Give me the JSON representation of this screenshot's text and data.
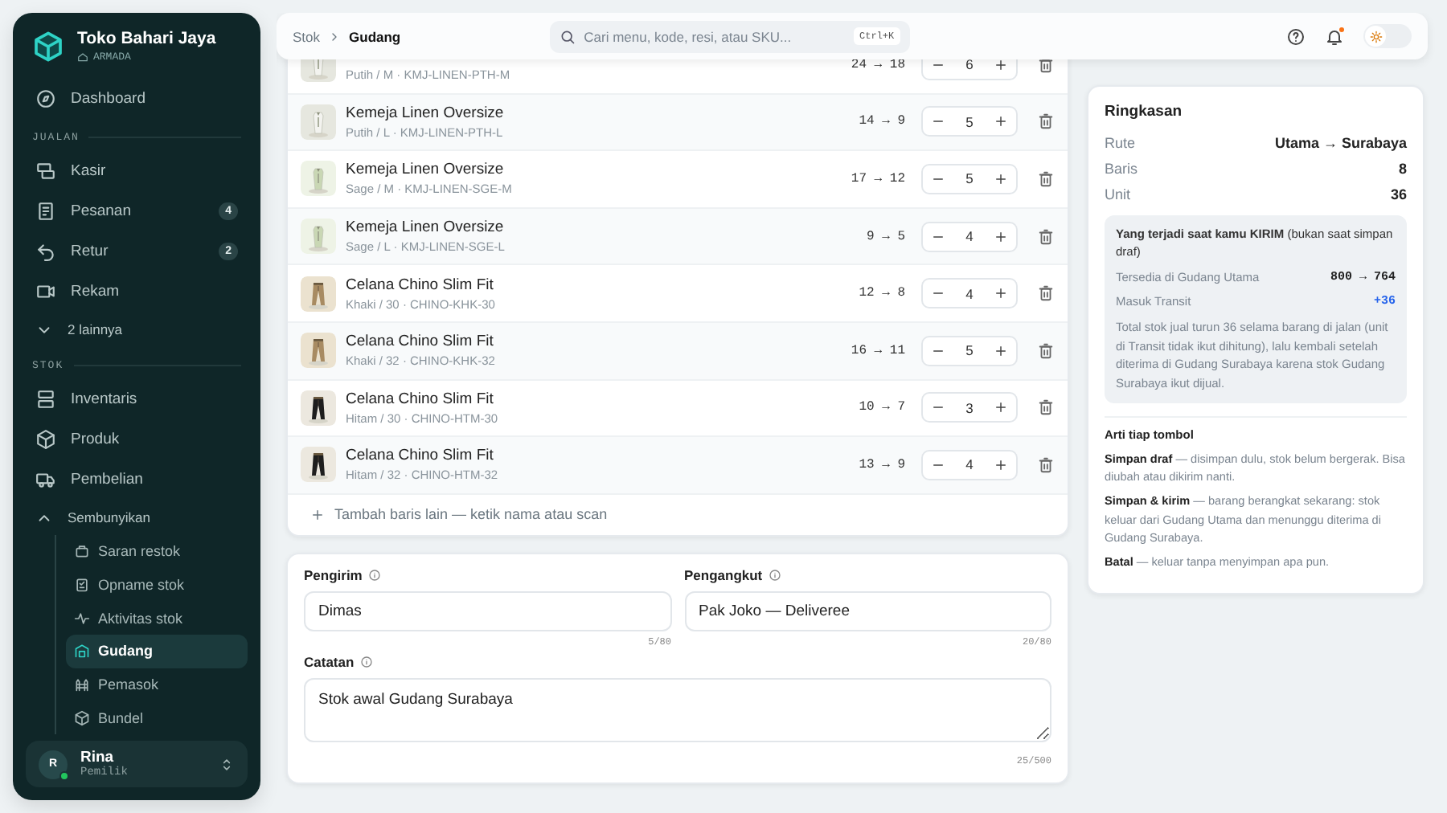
{
  "sidebar": {
    "brand": {
      "name": "Toko Bahari Jaya",
      "subtitle": "ARMADA"
    },
    "nav": [
      {
        "kind": "item",
        "label": "Dashboard",
        "selected": false
      },
      {
        "kind": "section",
        "label": "JUALAN"
      },
      {
        "kind": "item",
        "label": "Kasir",
        "selected": false
      },
      {
        "kind": "item",
        "label": "Pesanan",
        "badge": "4",
        "selected": false
      },
      {
        "kind": "item",
        "label": "Retur",
        "badge": "2",
        "selected": false
      },
      {
        "kind": "item",
        "label": "Rekam",
        "selected": false
      },
      {
        "kind": "toggle",
        "label": "2 lainnya",
        "expanded": false
      },
      {
        "kind": "section",
        "label": "STOK"
      },
      {
        "kind": "item",
        "label": "Inventaris",
        "selected": false
      },
      {
        "kind": "item",
        "label": "Produk",
        "selected": false
      },
      {
        "kind": "item",
        "label": "Pembelian",
        "selected": false
      },
      {
        "kind": "toggle",
        "label": "Sembunyikan",
        "expanded": true,
        "children": [
          {
            "label": "Saran restok",
            "selected": false
          },
          {
            "label": "Opname stok",
            "selected": false
          },
          {
            "label": "Aktivitas stok",
            "selected": false
          },
          {
            "label": "Gudang",
            "selected": true
          },
          {
            "label": "Pemasok",
            "selected": false
          },
          {
            "label": "Bundel",
            "selected": false
          }
        ]
      }
    ],
    "user": {
      "initial": "R",
      "name": "Rina",
      "role": "Pemilik",
      "online": true
    }
  },
  "header": {
    "breadcrumb": [
      {
        "label": "Stok",
        "current": false
      },
      {
        "label": "Gudang",
        "current": true
      }
    ],
    "search": {
      "placeholder": "Cari menu, kode, resi, atau SKU...",
      "shortcut": "Ctrl+K"
    },
    "notifications_unread": true,
    "dark_mode": false
  },
  "lines": {
    "rows": [
      {
        "variant": "Putih / M · KMJ-LINEN-PTH-M",
        "stock": "24 → 18",
        "qty": "6"
      },
      {
        "name": "Kemeja Linen Oversize",
        "variant": "Putih / L · KMJ-LINEN-PTH-L",
        "stock": "14 → 9",
        "qty": "5"
      },
      {
        "name": "Kemeja Linen Oversize",
        "variant": "Sage / M · KMJ-LINEN-SGE-M",
        "stock": "17 → 12",
        "qty": "5"
      },
      {
        "name": "Kemeja Linen Oversize",
        "variant": "Sage / L · KMJ-LINEN-SGE-L",
        "stock": "9 → 5",
        "qty": "4"
      },
      {
        "name": "Celana Chino Slim Fit",
        "variant": "Khaki / 30 · CHINO-KHK-30",
        "stock": "12 → 8",
        "qty": "4"
      },
      {
        "name": "Celana Chino Slim Fit",
        "variant": "Khaki / 32 · CHINO-KHK-32",
        "stock": "16 → 11",
        "qty": "5"
      },
      {
        "name": "Celana Chino Slim Fit",
        "variant": "Hitam / 30 · CHINO-HTM-30",
        "stock": "10 → 7",
        "qty": "3"
      },
      {
        "name": "Celana Chino Slim Fit",
        "variant": "Hitam / 32 · CHINO-HTM-32",
        "stock": "13 → 9",
        "qty": "4"
      }
    ],
    "add_row": "Tambah baris lain — ketik nama atau scan"
  },
  "form": {
    "fields": [
      {
        "label": "Pengirim",
        "value": "Dimas",
        "counter": "5/80"
      },
      {
        "label": "Pengangkut",
        "value": "Pak Joko — Deliveree",
        "counter": "20/80"
      }
    ],
    "notes": {
      "label": "Catatan",
      "value": "Stok awal Gudang Surabaya",
      "counter": "25/500"
    }
  },
  "summary": {
    "title": "Ringkasan",
    "rows": [
      {
        "label": "Rute",
        "value": "Utama → Surabaya"
      },
      {
        "label": "Baris",
        "value": "8"
      },
      {
        "label": "Unit",
        "value": "36"
      }
    ],
    "effect": {
      "title": "**Yang terjadi saat kamu KIRIM** (bukan saat simpan draf)",
      "rows": [
        {
          "label": "Tersedia di Gudang Utama",
          "value": "800 → 764",
          "kind": "plain"
        },
        {
          "label": "Masuk Transit",
          "value": "+36",
          "kind": "increase"
        }
      ],
      "note": "Total stok jual turun 36 selama barang di jalan (unit di Transit tidak ikut dihitung), lalu kembali setelah diterima di Gudang Surabaya karena stok Gudang Surabaya ikut dijual."
    },
    "legend": {
      "title": "Arti tiap tombol",
      "items": [
        "**Simpan draf** — disimpan dulu, stok belum bergerak. Bisa diubah atau dikirim nanti.",
        "**Simpan & kirim** — barang berangkat sekarang: stok keluar dari Gudang Utama dan menunggu diterima di Gudang Surabaya.",
        "**Batal** — keluar tanpa menyimpan apa pun."
      ]
    }
  }
}
